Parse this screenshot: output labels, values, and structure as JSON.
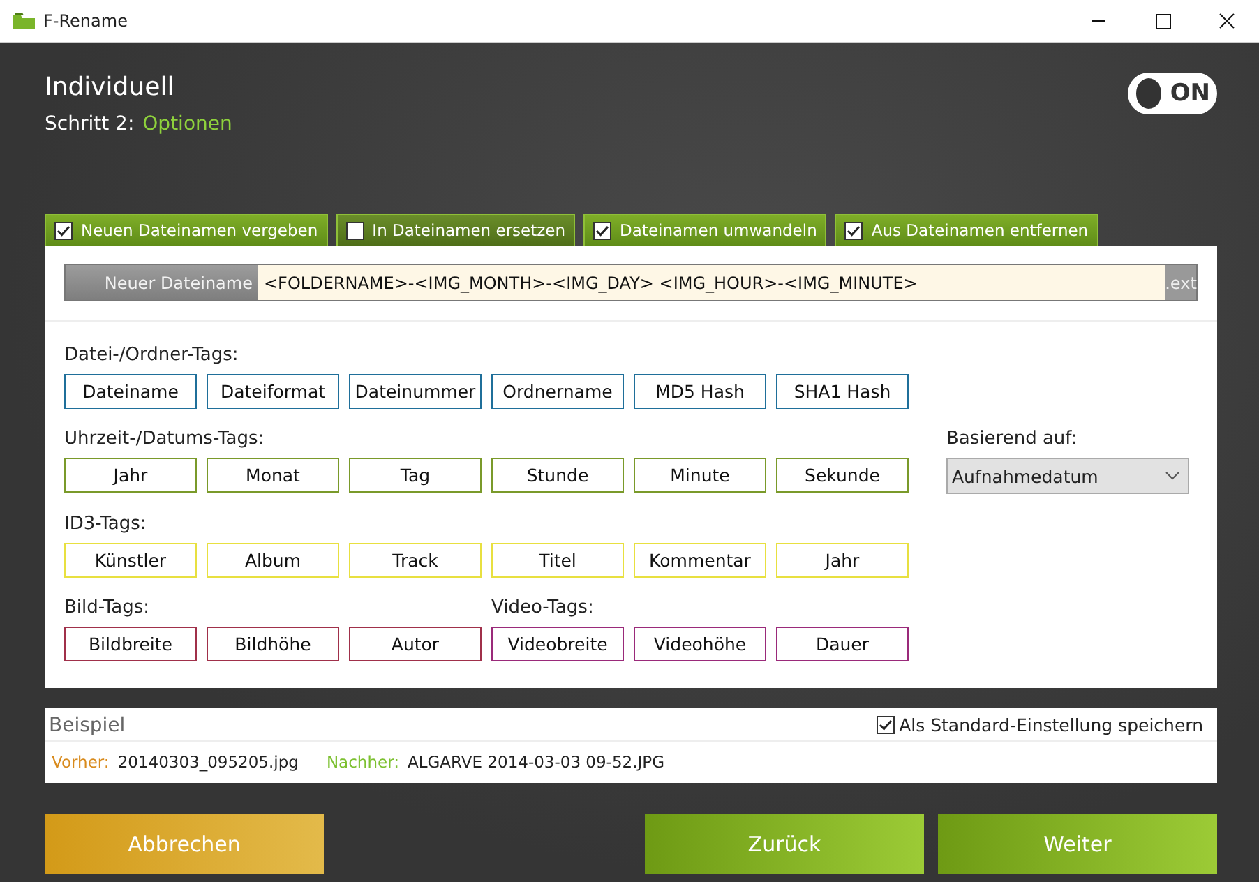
{
  "window": {
    "title": "F-Rename"
  },
  "header": {
    "title": "Individuell",
    "step_label": "Schritt 2:",
    "step_name": "Optionen"
  },
  "toggle": {
    "label": "ON",
    "on": true
  },
  "tabs": [
    {
      "label": "Neuen Dateinamen vergeben",
      "checked": true
    },
    {
      "label": "In Dateinamen ersetzen",
      "checked": false
    },
    {
      "label": "Dateinamen umwandeln",
      "checked": true
    },
    {
      "label": "Aus Dateinamen entfernen",
      "checked": true
    }
  ],
  "filename": {
    "label": "Neuer Dateiname",
    "value": "<FOLDERNAME>-<IMG_MONTH>-<IMG_DAY> <IMG_HOUR>-<IMG_MINUTE>",
    "extension": ".ext"
  },
  "tag_rows": [
    {
      "sections": [
        {
          "title": "Datei-/Ordner-Tags:",
          "color": "#1f6f9a",
          "tags": [
            "Dateiname",
            "Dateiformat",
            "Dateinummer",
            "Ordnername",
            "MD5 Hash",
            "SHA1 Hash"
          ]
        }
      ]
    },
    {
      "sections": [
        {
          "title": "Uhrzeit-/Datums-Tags:",
          "color": "#7a9a2a",
          "tags": [
            "Jahr",
            "Monat",
            "Tag",
            "Stunde",
            "Minute",
            "Sekunde"
          ]
        }
      ]
    },
    {
      "sections": [
        {
          "title": "ID3-Tags:",
          "color": "#e8e040",
          "tags": [
            "Künstler",
            "Album",
            "Track",
            "Titel",
            "Kommentar",
            "Jahr"
          ]
        }
      ]
    },
    {
      "sections": [
        {
          "title": "Bild-Tags:",
          "color": "#a0304a",
          "tags": [
            "Bildbreite",
            "Bildhöhe",
            "Autor"
          ]
        },
        {
          "title": "Video-Tags:",
          "color": "#9a2a7a",
          "tags": [
            "Videobreite",
            "Videohöhe",
            "Dauer"
          ]
        }
      ]
    }
  ],
  "based_on": {
    "label": "Basierend auf:",
    "value": "Aufnahmedatum"
  },
  "example": {
    "title": "Beispiel",
    "save_default": {
      "label": "Als Standard-Einstellung speichern",
      "checked": true
    },
    "before_label": "Vorher:",
    "before": "20140303_095205.jpg",
    "after_label": "Nachher:",
    "after": "ALGARVE 2014-03-03 09-52.JPG"
  },
  "buttons": [
    {
      "label": "Abbrechen",
      "kind": "cancel"
    },
    {
      "label": "Zurück",
      "kind": "nav"
    },
    {
      "label": "Weiter",
      "kind": "nav"
    }
  ]
}
